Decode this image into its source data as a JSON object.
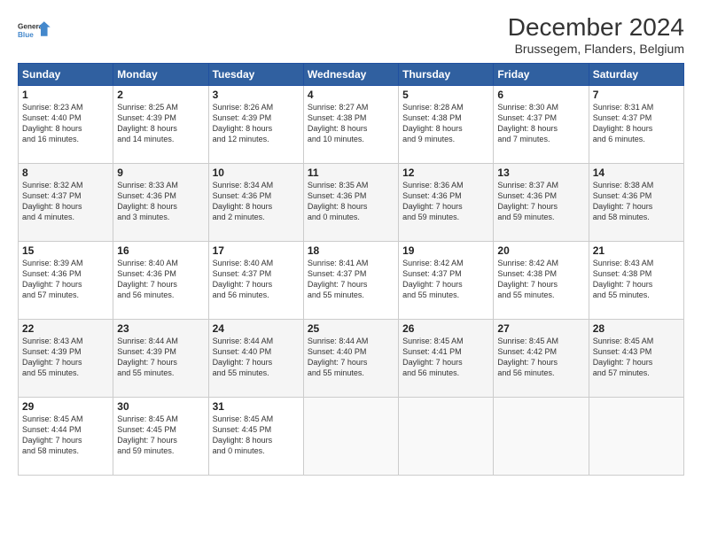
{
  "logo": {
    "line1": "General",
    "line2": "Blue"
  },
  "title": "December 2024",
  "subtitle": "Brussegem, Flanders, Belgium",
  "days_header": [
    "Sunday",
    "Monday",
    "Tuesday",
    "Wednesday",
    "Thursday",
    "Friday",
    "Saturday"
  ],
  "weeks": [
    [
      {
        "day": "1",
        "info": "Sunrise: 8:23 AM\nSunset: 4:40 PM\nDaylight: 8 hours\nand 16 minutes."
      },
      {
        "day": "2",
        "info": "Sunrise: 8:25 AM\nSunset: 4:39 PM\nDaylight: 8 hours\nand 14 minutes."
      },
      {
        "day": "3",
        "info": "Sunrise: 8:26 AM\nSunset: 4:39 PM\nDaylight: 8 hours\nand 12 minutes."
      },
      {
        "day": "4",
        "info": "Sunrise: 8:27 AM\nSunset: 4:38 PM\nDaylight: 8 hours\nand 10 minutes."
      },
      {
        "day": "5",
        "info": "Sunrise: 8:28 AM\nSunset: 4:38 PM\nDaylight: 8 hours\nand 9 minutes."
      },
      {
        "day": "6",
        "info": "Sunrise: 8:30 AM\nSunset: 4:37 PM\nDaylight: 8 hours\nand 7 minutes."
      },
      {
        "day": "7",
        "info": "Sunrise: 8:31 AM\nSunset: 4:37 PM\nDaylight: 8 hours\nand 6 minutes."
      }
    ],
    [
      {
        "day": "8",
        "info": "Sunrise: 8:32 AM\nSunset: 4:37 PM\nDaylight: 8 hours\nand 4 minutes."
      },
      {
        "day": "9",
        "info": "Sunrise: 8:33 AM\nSunset: 4:36 PM\nDaylight: 8 hours\nand 3 minutes."
      },
      {
        "day": "10",
        "info": "Sunrise: 8:34 AM\nSunset: 4:36 PM\nDaylight: 8 hours\nand 2 minutes."
      },
      {
        "day": "11",
        "info": "Sunrise: 8:35 AM\nSunset: 4:36 PM\nDaylight: 8 hours\nand 0 minutes."
      },
      {
        "day": "12",
        "info": "Sunrise: 8:36 AM\nSunset: 4:36 PM\nDaylight: 7 hours\nand 59 minutes."
      },
      {
        "day": "13",
        "info": "Sunrise: 8:37 AM\nSunset: 4:36 PM\nDaylight: 7 hours\nand 59 minutes."
      },
      {
        "day": "14",
        "info": "Sunrise: 8:38 AM\nSunset: 4:36 PM\nDaylight: 7 hours\nand 58 minutes."
      }
    ],
    [
      {
        "day": "15",
        "info": "Sunrise: 8:39 AM\nSunset: 4:36 PM\nDaylight: 7 hours\nand 57 minutes."
      },
      {
        "day": "16",
        "info": "Sunrise: 8:40 AM\nSunset: 4:36 PM\nDaylight: 7 hours\nand 56 minutes."
      },
      {
        "day": "17",
        "info": "Sunrise: 8:40 AM\nSunset: 4:37 PM\nDaylight: 7 hours\nand 56 minutes."
      },
      {
        "day": "18",
        "info": "Sunrise: 8:41 AM\nSunset: 4:37 PM\nDaylight: 7 hours\nand 55 minutes."
      },
      {
        "day": "19",
        "info": "Sunrise: 8:42 AM\nSunset: 4:37 PM\nDaylight: 7 hours\nand 55 minutes."
      },
      {
        "day": "20",
        "info": "Sunrise: 8:42 AM\nSunset: 4:38 PM\nDaylight: 7 hours\nand 55 minutes."
      },
      {
        "day": "21",
        "info": "Sunrise: 8:43 AM\nSunset: 4:38 PM\nDaylight: 7 hours\nand 55 minutes."
      }
    ],
    [
      {
        "day": "22",
        "info": "Sunrise: 8:43 AM\nSunset: 4:39 PM\nDaylight: 7 hours\nand 55 minutes."
      },
      {
        "day": "23",
        "info": "Sunrise: 8:44 AM\nSunset: 4:39 PM\nDaylight: 7 hours\nand 55 minutes."
      },
      {
        "day": "24",
        "info": "Sunrise: 8:44 AM\nSunset: 4:40 PM\nDaylight: 7 hours\nand 55 minutes."
      },
      {
        "day": "25",
        "info": "Sunrise: 8:44 AM\nSunset: 4:40 PM\nDaylight: 7 hours\nand 55 minutes."
      },
      {
        "day": "26",
        "info": "Sunrise: 8:45 AM\nSunset: 4:41 PM\nDaylight: 7 hours\nand 56 minutes."
      },
      {
        "day": "27",
        "info": "Sunrise: 8:45 AM\nSunset: 4:42 PM\nDaylight: 7 hours\nand 56 minutes."
      },
      {
        "day": "28",
        "info": "Sunrise: 8:45 AM\nSunset: 4:43 PM\nDaylight: 7 hours\nand 57 minutes."
      }
    ],
    [
      {
        "day": "29",
        "info": "Sunrise: 8:45 AM\nSunset: 4:44 PM\nDaylight: 7 hours\nand 58 minutes."
      },
      {
        "day": "30",
        "info": "Sunrise: 8:45 AM\nSunset: 4:45 PM\nDaylight: 7 hours\nand 59 minutes."
      },
      {
        "day": "31",
        "info": "Sunrise: 8:45 AM\nSunset: 4:45 PM\nDaylight: 8 hours\nand 0 minutes."
      },
      {
        "day": "",
        "info": ""
      },
      {
        "day": "",
        "info": ""
      },
      {
        "day": "",
        "info": ""
      },
      {
        "day": "",
        "info": ""
      }
    ]
  ]
}
